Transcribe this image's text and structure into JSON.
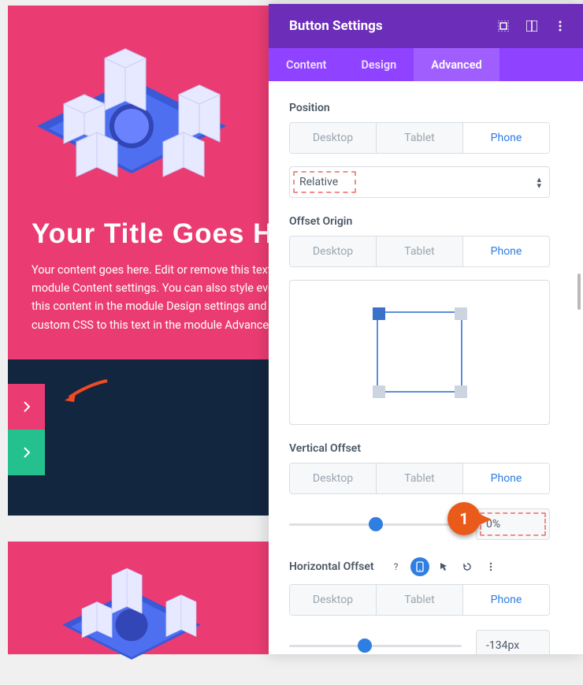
{
  "hero": {
    "title": "Your Title Goes Here",
    "body": "Your content goes here. Edit or remove this text inline or in the module Content settings. You can also style every aspect of this content in the module Design settings and even apply custom CSS to this text in the module Advanced settings."
  },
  "annotations": {
    "callout1": "1"
  },
  "panel": {
    "title": "Button Settings",
    "tabs": {
      "content": "Content",
      "design": "Design",
      "advanced": "Advanced"
    }
  },
  "device": {
    "desktop": "Desktop",
    "tablet": "Tablet",
    "phone": "Phone"
  },
  "position": {
    "label": "Position",
    "select": "Relative"
  },
  "offsetOrigin": {
    "label": "Offset Origin"
  },
  "verticalOffset": {
    "label": "Vertical Offset",
    "value": "0%"
  },
  "horizontalOffset": {
    "label": "Horizontal Offset",
    "value": "-134px"
  }
}
